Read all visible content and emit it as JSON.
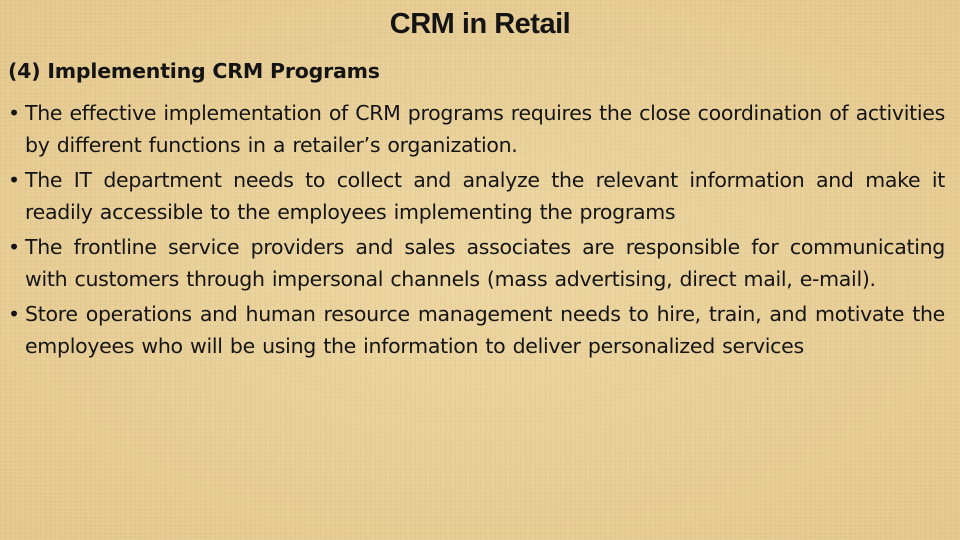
{
  "slide": {
    "title": "CRM in Retail",
    "subtitle": "(4) Implementing CRM Programs",
    "bullet_glyph": "•",
    "bullets": [
      "The effective implementation of CRM programs requires the close coordination of activities by different functions in a retailer’s organization.",
      "The IT department needs to collect and analyze the relevant information and make it readily accessible to the employees implementing the programs",
      "The frontline service providers and sales associates are responsible for communicating with customers through impersonal channels (mass advertising, direct mail, e-mail).",
      "Store operations and human resource management needs to hire, train, and motivate the employees who will be using the information to deliver personalized services"
    ]
  }
}
